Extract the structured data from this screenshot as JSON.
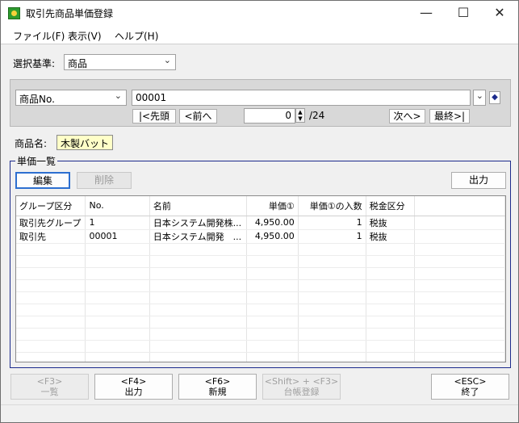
{
  "window": {
    "title": "取引先商品単価登録",
    "minimize_glyph": "—",
    "maximize_glyph": "☐",
    "close_glyph": "✕",
    "icon": "app-icon"
  },
  "menu": {
    "file": "ファイル(F)",
    "view": "表示(V)",
    "help": "ヘルプ(H)"
  },
  "criteria": {
    "label": "選択基準:",
    "value": "商品"
  },
  "search": {
    "field": "商品No.",
    "value": "00001",
    "first_label": "|<先頭",
    "prev_label": "<前へ",
    "next_label": "次へ>",
    "last_label": "最終>|",
    "position": "0",
    "total": "/24"
  },
  "product": {
    "label": "商品名:",
    "name": "木製バット"
  },
  "price_list": {
    "legend": "単価一覧",
    "edit_label": "編集",
    "delete_label": "削除",
    "output_label": "出力",
    "columns": [
      "グループ区分",
      "No.",
      "名前",
      "単価①",
      "単価①の入数",
      "税金区分"
    ],
    "rows": [
      [
        "取引先グループ",
        "1",
        "日本システム開発株...",
        "4,950.00",
        "1",
        "税抜"
      ],
      [
        "取引先",
        "00001",
        "日本システム開発　...",
        "4,950.00",
        "1",
        "税抜"
      ]
    ]
  },
  "footer": {
    "f3": {
      "key": "<F3>",
      "label": "一覧"
    },
    "f4": {
      "key": "<F4>",
      "label": "出力"
    },
    "f6": {
      "key": "<F6>",
      "label": "新規"
    },
    "shift_f3": {
      "key": "<Shift> + <F3>",
      "label": "台帳登録"
    },
    "esc": {
      "key": "<ESC>",
      "label": "終了"
    }
  },
  "colors": {
    "window_bg": "#f0f0f0",
    "panel_bg": "#d8d8d8",
    "name_highlight": "#ffffc8",
    "group_border": "#1c2b8c",
    "accent": "#2d6fd0"
  }
}
